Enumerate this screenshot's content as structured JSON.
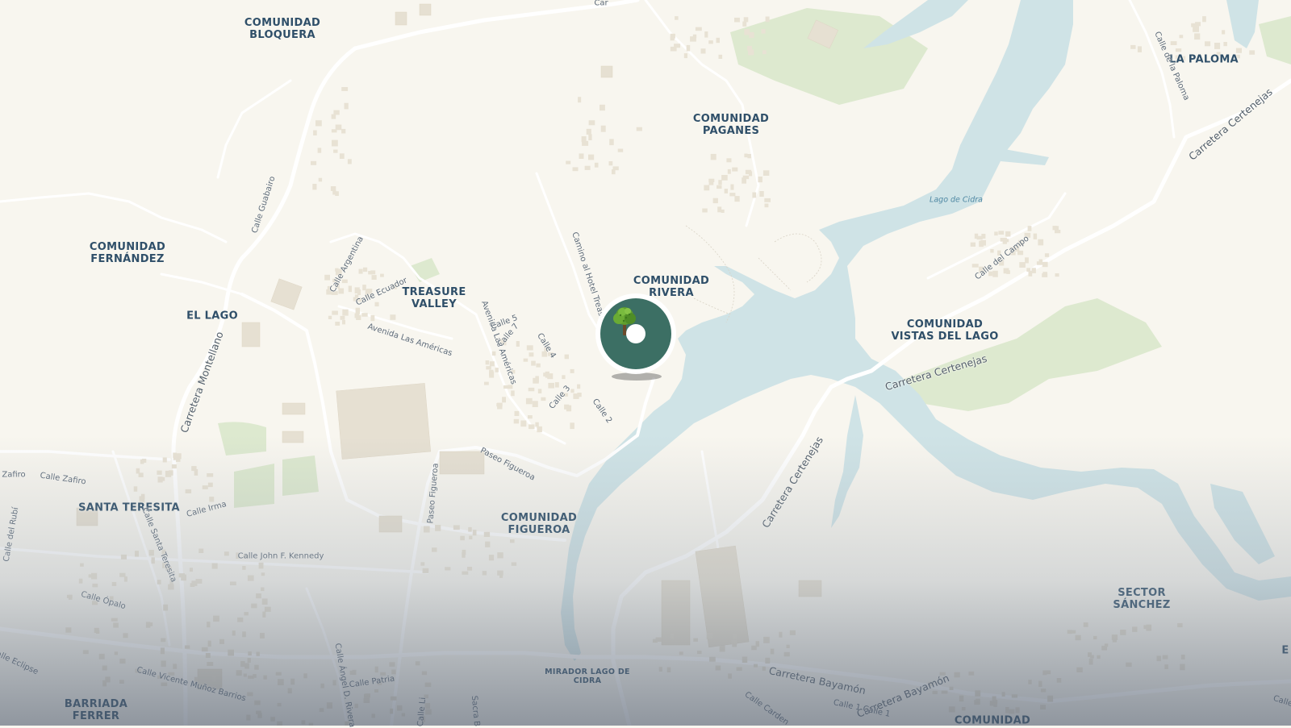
{
  "map": {
    "colors": {
      "land": "#f8f6ef",
      "water": "#cfe3e6",
      "park": "#dde9cf",
      "building": "#e6e0d2",
      "road": "#ffffff",
      "label": "#2f4f69",
      "marker": "#3c6f64"
    },
    "places": [
      {
        "id": "comunidad-bloquera",
        "text": "COMUNIDAD\nBLOQUERA"
      },
      {
        "id": "la-paloma",
        "text": "LA PALOMA"
      },
      {
        "id": "comunidad-paganes",
        "text": "COMUNIDAD\nPAGANES"
      },
      {
        "id": "comunidad-fernandez",
        "text": "COMUNIDAD\nFERNÁNDEZ"
      },
      {
        "id": "treasure-valley",
        "text": "TREASURE\nVALLEY"
      },
      {
        "id": "comunidad-rivera",
        "text": "COMUNIDAD\nRIVERA"
      },
      {
        "id": "el-lago",
        "text": "EL LAGO"
      },
      {
        "id": "comunidad-vistas-del-lago",
        "text": "COMUNIDAD\nVISTAS DEL LAGO"
      },
      {
        "id": "santa-teresita",
        "text": "SANTA TERESITA"
      },
      {
        "id": "comunidad-figueroa",
        "text": "COMUNIDAD\nFIGUEROA"
      },
      {
        "id": "sector-sanchez",
        "text": "SECTOR\nSÁNCHEZ"
      },
      {
        "id": "mirador-lago-de-cidra",
        "text": "MIRADOR LAGO DE\nCIDRA"
      },
      {
        "id": "barriada-ferrer",
        "text": "BARRIADA\nFERRER"
      },
      {
        "id": "comunidad-bottom",
        "text": "COMUNIDAD"
      },
      {
        "id": "edge-e",
        "text": "E"
      }
    ],
    "water_label": "Lago de Cidra",
    "streets": [
      {
        "id": "car-top",
        "text": "Car"
      },
      {
        "id": "calle-de-la-paloma",
        "text": "Calle de la Paloma"
      },
      {
        "id": "carretera-certenejas-ne",
        "text": "Carretera Certenejas"
      },
      {
        "id": "calle-guabairo",
        "text": "Calle Guabairo"
      },
      {
        "id": "calle-argentina",
        "text": "Calle Argentina"
      },
      {
        "id": "calle-ecuador",
        "text": "Calle Ecuador"
      },
      {
        "id": "avenida-las-americas-1",
        "text": "Avenida Las Américas"
      },
      {
        "id": "avenida-las-americas-2",
        "text": "Avenida Las Américas"
      },
      {
        "id": "camino-al-hotel-treasur",
        "text": "Camino al Hotel Treasur"
      },
      {
        "id": "calle-5",
        "text": "Calle 5"
      },
      {
        "id": "calle-7",
        "text": "Calle 7"
      },
      {
        "id": "calle-4",
        "text": "Calle 4"
      },
      {
        "id": "calle-3",
        "text": "Calle 3"
      },
      {
        "id": "calle-2",
        "text": "Calle 2"
      },
      {
        "id": "calle-del-campo",
        "text": "Calle del Campo"
      },
      {
        "id": "carretera-certenejas-mid",
        "text": "Carretera Certenejas"
      },
      {
        "id": "carretera-montellano",
        "text": "Carretera Montellano"
      },
      {
        "id": "paseo-figueroa-1",
        "text": "Paseo Figueroa"
      },
      {
        "id": "paseo-figueroa-2",
        "text": "Paseo Figueroa"
      },
      {
        "id": "carretera-certenejas-s",
        "text": "Carretera Certenejas"
      },
      {
        "id": "zafiro",
        "text": "Zafiro"
      },
      {
        "id": "calle-zafiro",
        "text": "Calle Zafiro"
      },
      {
        "id": "calle-irma",
        "text": "Calle Irma"
      },
      {
        "id": "calle-santa-teresita",
        "text": "Calle Santa Teresita"
      },
      {
        "id": "calle-del-rubi",
        "text": "Calle del Rubí"
      },
      {
        "id": "calle-john-f-kennedy",
        "text": "Calle John F. Kennedy"
      },
      {
        "id": "calle-opalo",
        "text": "Calle Ópalo"
      },
      {
        "id": "calle-eclipse",
        "text": "Calle Eclipse"
      },
      {
        "id": "calle-vicente-munoz-barrios",
        "text": "Calle Vicente Muñoz Barrios"
      },
      {
        "id": "calle-angel-d-rivera",
        "text": "Calle Ángel D. Rivera"
      },
      {
        "id": "calle-patria",
        "text": "Calle Patria"
      },
      {
        "id": "calle-li",
        "text": "Calle Li"
      },
      {
        "id": "sacra-fragment",
        "text": "Sacra B"
      },
      {
        "id": "carretera-bayamon-1",
        "text": "Carretera Bayamón"
      },
      {
        "id": "carretera-bayamon-2",
        "text": "Carretera Bayamón"
      },
      {
        "id": "calle-carden",
        "text": "Calle Carden"
      },
      {
        "id": "calle-1-calle-1",
        "text": "Calle 1 Calle 1"
      },
      {
        "id": "calle-edge",
        "text": "Calle"
      }
    ],
    "marker": {
      "icon": "tree-icon",
      "color": "#3c6f64"
    }
  }
}
